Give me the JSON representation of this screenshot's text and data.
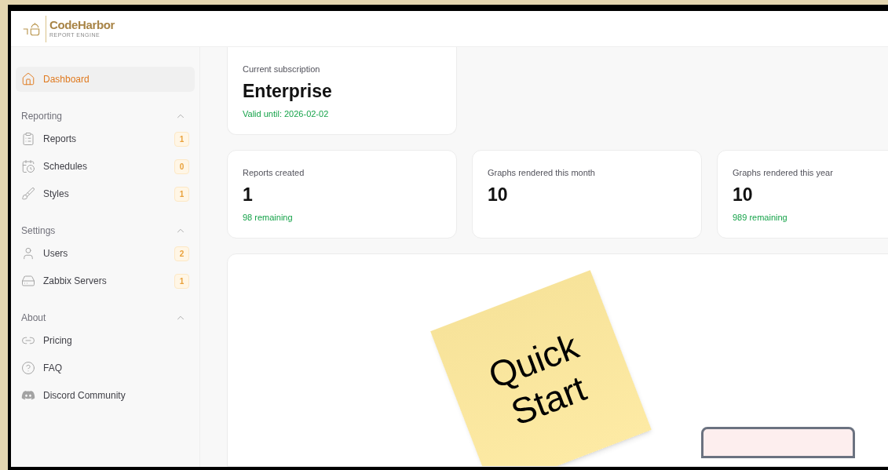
{
  "logo": {
    "name": "CodeHarbor",
    "tagline": "REPORT ENGINE"
  },
  "sidebar": {
    "top_item": {
      "label": "Dashboard",
      "selected": true
    },
    "sections": [
      {
        "title": "Reporting",
        "expanded": true,
        "items": [
          {
            "label": "Reports",
            "badge": "1",
            "selected": false
          },
          {
            "label": "Schedules",
            "badge": "0",
            "selected": false
          },
          {
            "label": "Styles",
            "badge": "1",
            "selected": false
          }
        ]
      },
      {
        "title": "Settings",
        "expanded": true,
        "items": [
          {
            "label": "Users",
            "badge": "2",
            "selected": false
          },
          {
            "label": "Zabbix Servers",
            "badge": "1",
            "selected": false
          }
        ]
      },
      {
        "title": "About",
        "expanded": true,
        "items": [
          {
            "label": "Pricing",
            "selected": false
          },
          {
            "label": "FAQ",
            "selected": false
          },
          {
            "label": "Discord Community",
            "selected": false
          }
        ]
      }
    ]
  },
  "subscription": {
    "label": "Current subscription",
    "plan": "Enterprise",
    "valid": "Valid until: 2026-02-02"
  },
  "stats": [
    {
      "label": "Reports created",
      "value": "1",
      "note": "98 remaining"
    },
    {
      "label": "Graphs rendered this month",
      "value": "10"
    },
    {
      "label": "Graphs rendered this year",
      "value": "10",
      "note": "989 remaining"
    }
  ],
  "quick_start": {
    "note": "Quick Start"
  }
}
